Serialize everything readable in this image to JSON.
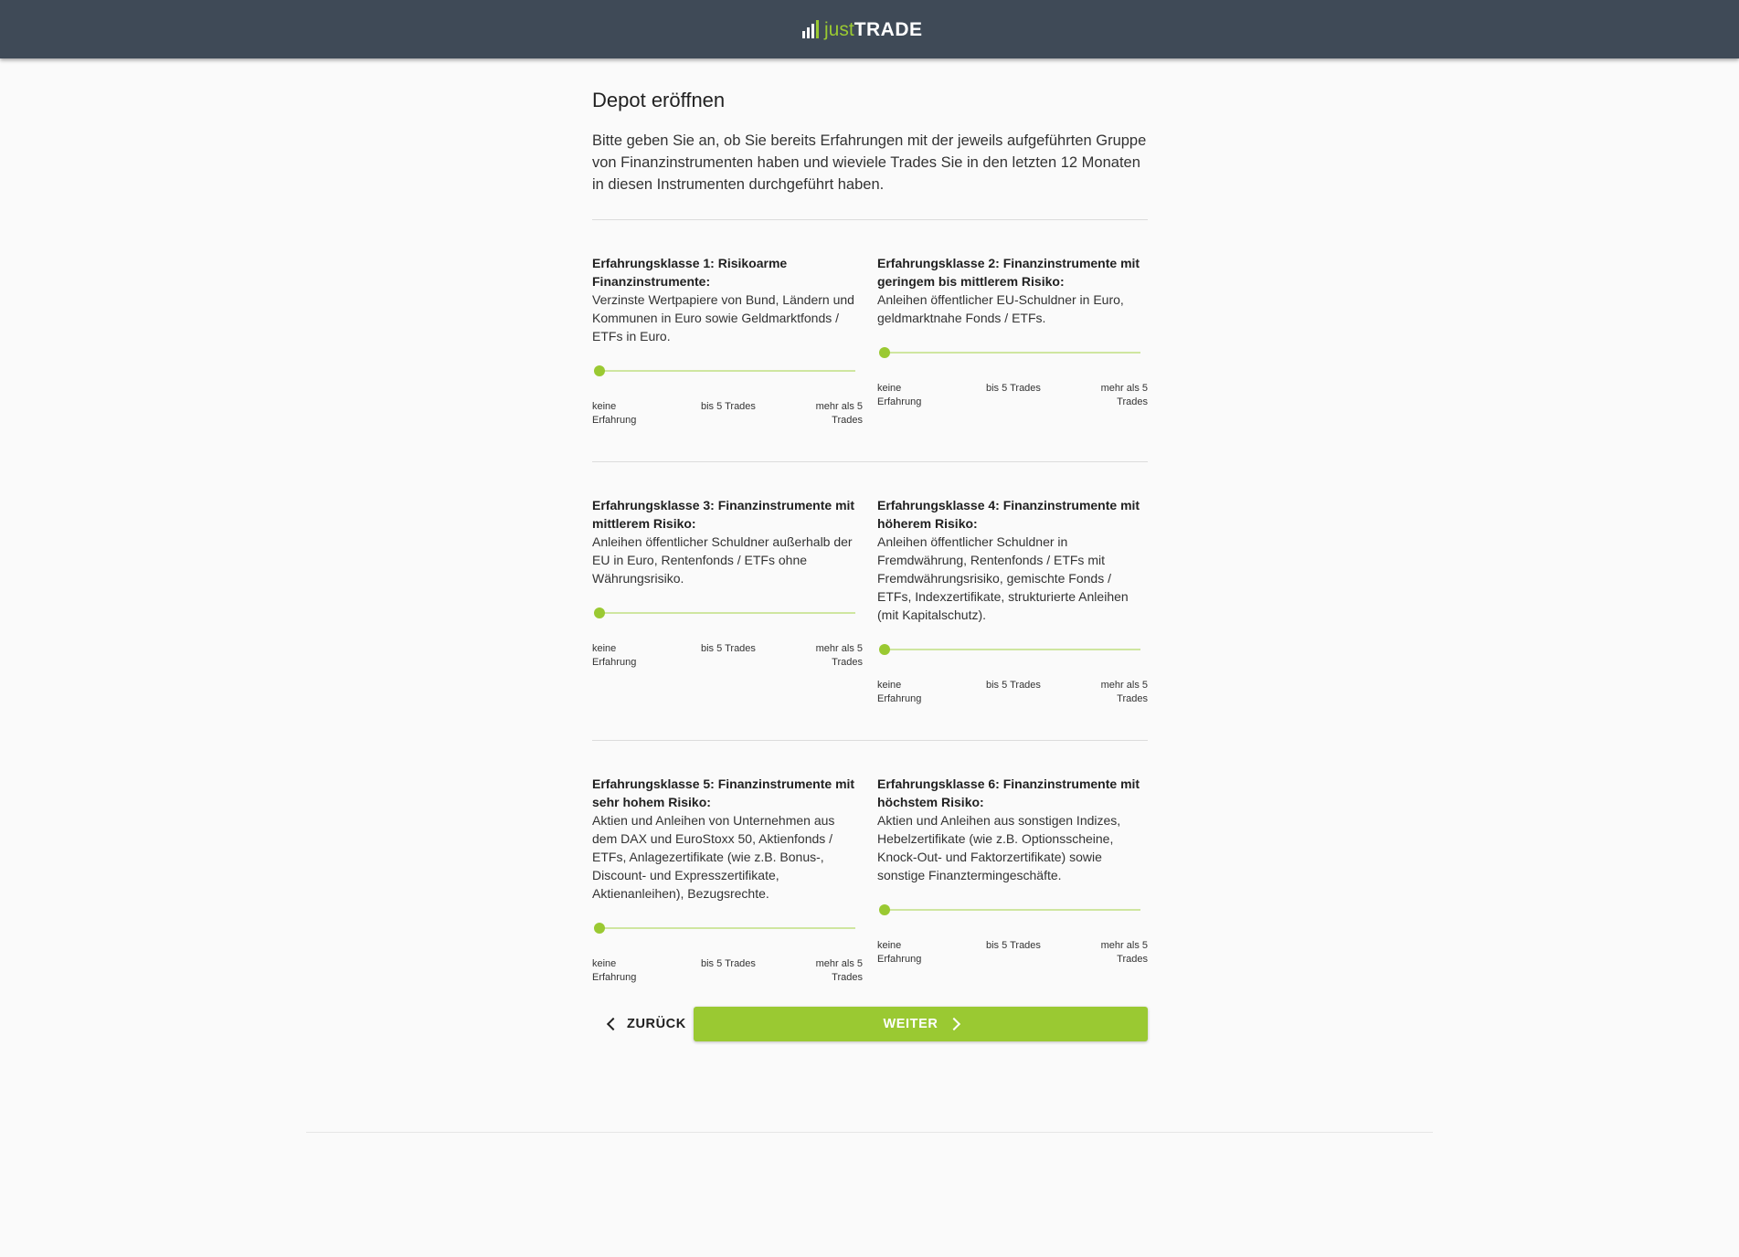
{
  "header": {
    "logo_just": "just",
    "logo_trade": "TRADE"
  },
  "page": {
    "title": "Depot eröffnen",
    "intro": "Bitte geben Sie an, ob Sie bereits Erfahrungen mit der jeweils aufgeführten Gruppe von Finanzinstrumenten haben und wieviele Trades Sie in den letzten 12 Monaten in diesen Instrumenten durchgeführt haben."
  },
  "slider_labels": {
    "none": "keine Erfahrung",
    "mid": "bis 5 Trades",
    "high": "mehr als 5 Trades"
  },
  "classes": [
    {
      "title": "Erfahrungsklasse 1: Risikoarme Finanzinstrumente:",
      "desc": "Verzinste Wertpapiere von Bund, Ländern und Kommunen in Euro sowie Geldmarktfonds / ETFs in Euro.",
      "value": 0
    },
    {
      "title": "Erfahrungsklasse 2: Finanzinstrumente mit geringem bis mittlerem Risiko:",
      "desc": "Anleihen öffentlicher EU-Schuldner in Euro, geldmarktnahe Fonds / ETFs.",
      "value": 0
    },
    {
      "title": "Erfahrungsklasse 3: Finanzinstrumente mit mittlerem Risiko:",
      "desc": "Anleihen öffentlicher Schuldner außerhalb der EU in Euro, Rentenfonds / ETFs ohne Währungsrisiko.",
      "value": 0
    },
    {
      "title": "Erfahrungsklasse 4: Finanzinstrumente mit höherem Risiko:",
      "desc": "Anleihen öffentlicher Schuldner in Fremdwährung, Rentenfonds / ETFs mit Fremdwährungsrisiko, gemischte Fonds / ETFs, Indexzertifikate, strukturierte Anleihen (mit Kapitalschutz).",
      "value": 0
    },
    {
      "title": "Erfahrungsklasse 5: Finanzinstrumente mit sehr hohem Risiko:",
      "desc": "Aktien und Anleihen von Unternehmen aus dem DAX und EuroStoxx 50, Aktienfonds / ETFs, Anlagezertifikate (wie z.B. Bonus-, Discount- und Expresszertifikate, Aktienanleihen), Bezugsrechte.",
      "value": 0
    },
    {
      "title": "Erfahrungsklasse 6: Finanzinstrumente mit höchstem Risiko:",
      "desc": "Aktien und Anleihen aus sonstigen Indizes, Hebelzertifikate (wie z.B. Optionsscheine, Knock-Out- und Faktorzertifikate) sowie sonstige Finanztermingeschäfte.",
      "value": 0
    }
  ],
  "buttons": {
    "back": "ZURÜCK",
    "next": "WEITER"
  },
  "colors": {
    "header_bg": "#3f4a57",
    "accent": "#9ac932"
  }
}
